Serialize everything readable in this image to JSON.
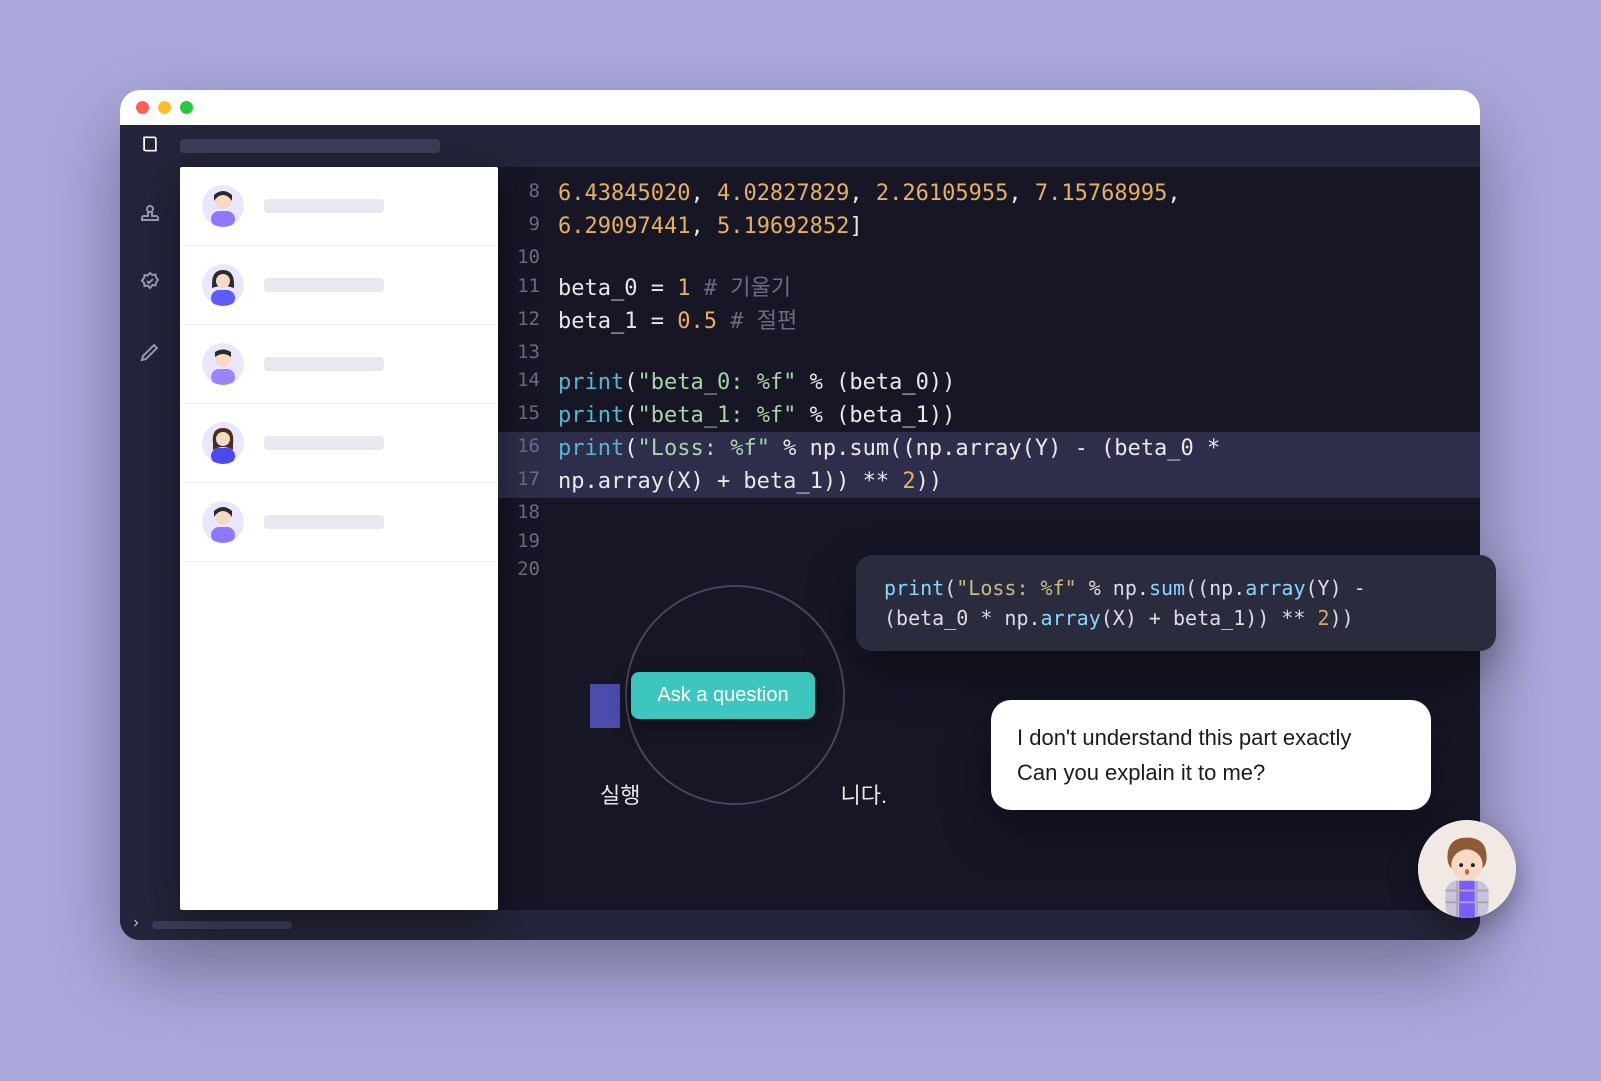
{
  "window": {
    "title_placeholder": ""
  },
  "sidebar_icons": [
    "stamp-icon",
    "check-badge-icon",
    "pencil-icon"
  ],
  "people": [
    {
      "avatar": "person-1",
      "label": ""
    },
    {
      "avatar": "person-2",
      "label": ""
    },
    {
      "avatar": "person-3",
      "label": ""
    },
    {
      "avatar": "person-4",
      "label": ""
    },
    {
      "avatar": "person-5",
      "label": ""
    }
  ],
  "code_lines": [
    {
      "n": 8,
      "tokens": [
        [
          "num",
          "6.43845020"
        ],
        [
          "punct",
          ", "
        ],
        [
          "num",
          "4.02827829"
        ],
        [
          "punct",
          ", "
        ],
        [
          "num",
          "2.26105955"
        ],
        [
          "punct",
          ", "
        ],
        [
          "num",
          "7.15768995"
        ],
        [
          "punct",
          ","
        ]
      ]
    },
    {
      "n": 9,
      "tokens": [
        [
          "num",
          "6.29097441"
        ],
        [
          "punct",
          ", "
        ],
        [
          "num",
          "5.19692852"
        ],
        [
          "punct",
          "]"
        ]
      ]
    },
    {
      "n": 10,
      "tokens": []
    },
    {
      "n": 11,
      "tokens": [
        [
          "var",
          "beta_0 "
        ],
        [
          "op",
          "= "
        ],
        [
          "num",
          "1"
        ],
        [
          "var",
          " "
        ],
        [
          "comment",
          "# 기울기"
        ]
      ]
    },
    {
      "n": 12,
      "tokens": [
        [
          "var",
          "beta_1 "
        ],
        [
          "op",
          "= "
        ],
        [
          "num",
          "0.5"
        ],
        [
          "var",
          " "
        ],
        [
          "comment",
          "# 절편"
        ]
      ]
    },
    {
      "n": 13,
      "tokens": []
    },
    {
      "n": 14,
      "tokens": [
        [
          "fn",
          "print"
        ],
        [
          "punct",
          "("
        ],
        [
          "str",
          "\"beta_0: %f\""
        ],
        [
          "punct",
          " % (beta_0))"
        ]
      ]
    },
    {
      "n": 15,
      "tokens": [
        [
          "fn",
          "print"
        ],
        [
          "punct",
          "("
        ],
        [
          "str",
          "\"beta_1: %f\""
        ],
        [
          "punct",
          " % (beta_1))"
        ]
      ]
    },
    {
      "n": 16,
      "hl": true,
      "tokens": [
        [
          "fn",
          "print"
        ],
        [
          "punct",
          "("
        ],
        [
          "str",
          "\"Loss: %f\""
        ],
        [
          "punct",
          " % np.sum((np.array(Y) - (beta_0 * "
        ]
      ]
    },
    {
      "n": 17,
      "hl": true,
      "tokens": [
        [
          "punct",
          "np.array(X) + beta_1)) ** "
        ],
        [
          "num",
          "2"
        ],
        [
          "punct",
          "))"
        ]
      ]
    },
    {
      "n": 18,
      "tokens": []
    },
    {
      "n": 19,
      "tokens": []
    },
    {
      "n": 20,
      "tokens": []
    }
  ],
  "ask_button_label": "Ask a question",
  "status_text_prefix": "실행",
  "status_text_suffix": "니다.",
  "tooltip_code": {
    "line1": "print(\"Loss: %f\" % np.sum((np.array(Y) -",
    "line2": "(beta_0 * np.array(X) + beta_1)) ** 2))"
  },
  "chat": {
    "line1": "I don't understand this part exactly",
    "line2": "Can you explain it to me?"
  }
}
